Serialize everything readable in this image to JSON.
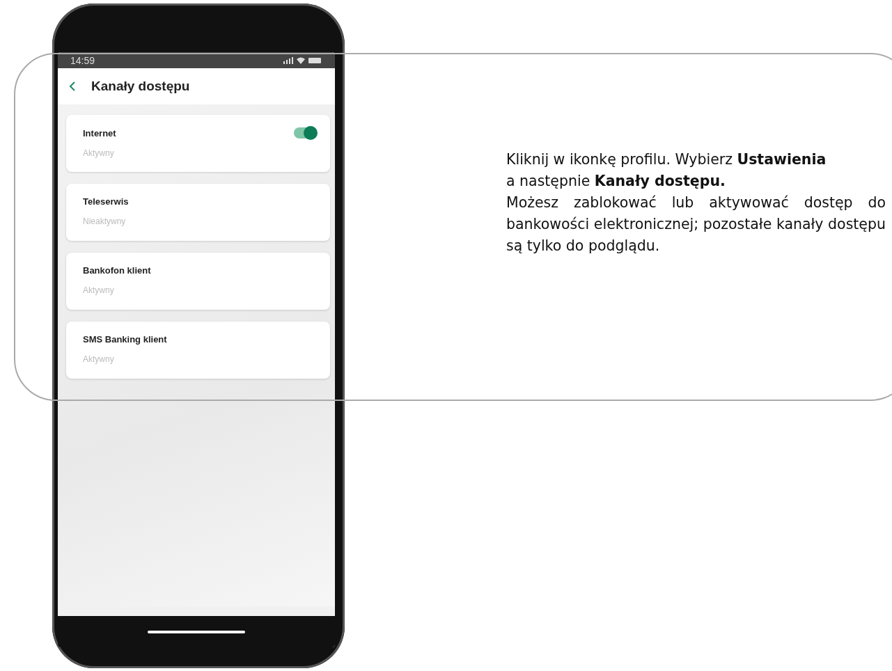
{
  "status_bar": {
    "time": "14:59"
  },
  "header": {
    "title": "Kanały dostępu"
  },
  "channels": [
    {
      "name": "Internet",
      "status": "Aktywny",
      "toggle": {
        "on": true
      }
    },
    {
      "name": "Teleserwis",
      "status": "Nieaktywny"
    },
    {
      "name": "Bankofon klient",
      "status": "Aktywny"
    },
    {
      "name": "SMS Banking klient",
      "status": "Aktywny"
    }
  ],
  "instructions": [
    "Kliknij w ikonkę profilu. Wybierz **Ustawienia**",
    "a następnie **Kanały dostępu.**",
    "Możesz zablokować lub aktywować dostęp do bankowości elektronicznej; pozostałe kanały dostępu są tylko do podglądu."
  ]
}
